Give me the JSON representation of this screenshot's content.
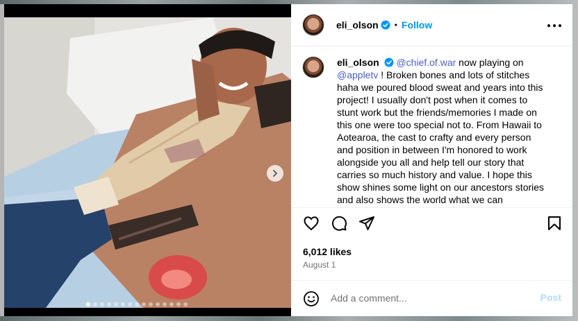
{
  "post": {
    "username": "eli_olson",
    "separator": "•",
    "follow_label": "Follow",
    "caption": {
      "username": "eli_olson",
      "mention_1": "@chief.of.war",
      "text_1": " now playing on ",
      "mention_2": "@appletv",
      "text_2": " ! Broken bones and lots of stitches haha we poured blood sweat and years into this project! I usually don't post when it comes to stunt work but the friends/memories I made on this one were too special not to. From Hawaii to Aotearoa, the cast to crafty and every person and position in between I'm honored to work alongside you all and help tell our story that carries so much history and value. I hope this show shines some light on our ancestors stories and also shows the world what we can"
    },
    "likes": "6,012 likes",
    "date": "August 1",
    "comment": {
      "placeholder": "Add a comment...",
      "post_label": "Post"
    },
    "carousel": {
      "slide_count": 15,
      "active_index": 0
    }
  },
  "icons": {
    "verified": "verified-badge-icon",
    "more": "more-options-icon",
    "like": "heart-icon",
    "comment": "comment-icon",
    "share": "share-icon",
    "save": "bookmark-icon",
    "emoji": "emoji-icon",
    "next": "chevron-right-icon"
  },
  "colors": {
    "accent": "#0095f6",
    "post_disabled": "#b3dbff",
    "verified": "#0095f6"
  }
}
